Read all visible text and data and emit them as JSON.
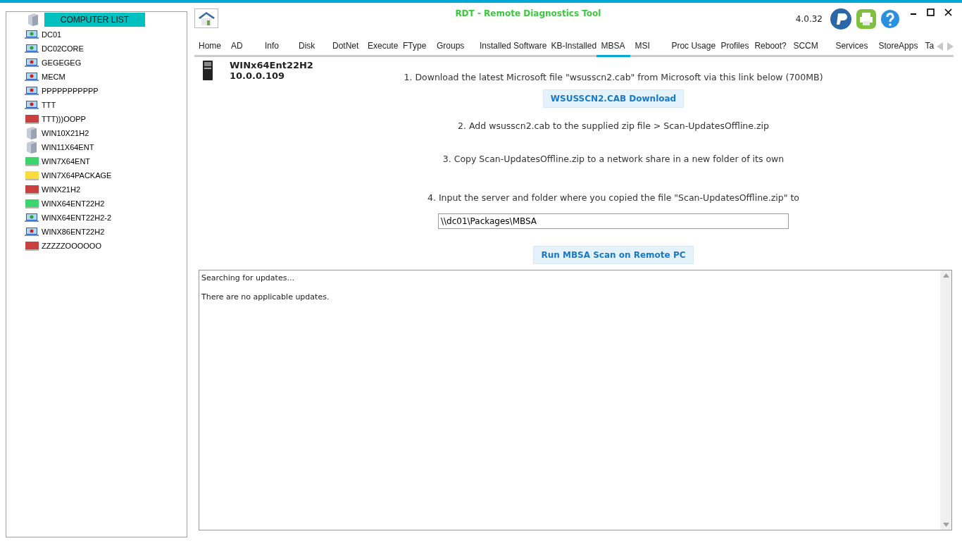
{
  "computer_list": {
    "title": "COMPUTER LIST",
    "items": [
      {
        "name": "DC01",
        "kind": "laptop-ok"
      },
      {
        "name": "DC02CORE",
        "kind": "laptop-ok"
      },
      {
        "name": "GEGEGEG",
        "kind": "laptop-alert"
      },
      {
        "name": "MECM",
        "kind": "laptop-alert"
      },
      {
        "name": "PPPPPPPPPPP",
        "kind": "laptop-alert"
      },
      {
        "name": "TTT",
        "kind": "laptop-alert"
      },
      {
        "name": "TTT)))OOPP",
        "kind": "status",
        "color": "#c84040"
      },
      {
        "name": "WIN10X21H2",
        "kind": "server"
      },
      {
        "name": "WIN11X64ENT",
        "kind": "server"
      },
      {
        "name": "WIN7X64ENT",
        "kind": "status",
        "color": "#3cd46c"
      },
      {
        "name": "WIN7X64PACKAGE",
        "kind": "status",
        "color": "#fadc3c"
      },
      {
        "name": "WINX21H2",
        "kind": "status",
        "color": "#c84040"
      },
      {
        "name": "WINX64ENT22H2",
        "kind": "status",
        "color": "#3cd46c"
      },
      {
        "name": "WINX64ENT22H2-2",
        "kind": "laptop-ok"
      },
      {
        "name": "WINX86ENT22H2",
        "kind": "laptop-alert"
      },
      {
        "name": "ZZZZZOOOOOO",
        "kind": "status",
        "color": "#c84040"
      }
    ]
  },
  "window": {
    "title": "RDT - Remote Diagnostics Tool",
    "version": "4.0.32"
  },
  "tabs": [
    {
      "label": "Home",
      "selected": false
    },
    {
      "label": "AD",
      "selected": false
    },
    {
      "label": "Info",
      "selected": false
    },
    {
      "label": "Disk",
      "selected": false
    },
    {
      "label": "DotNet",
      "selected": false
    },
    {
      "label": "Execute",
      "selected": false
    },
    {
      "label": "FType",
      "selected": false
    },
    {
      "label": "Groups",
      "selected": false
    },
    {
      "label": "Installed Software",
      "selected": false
    },
    {
      "label": "KB-Installed",
      "selected": false
    },
    {
      "label": "MBSA",
      "selected": true
    },
    {
      "label": "MSI",
      "selected": false
    },
    {
      "label": "Proc Usage",
      "selected": false
    },
    {
      "label": "Profiles",
      "selected": false
    },
    {
      "label": "Reboot?",
      "selected": false
    },
    {
      "label": "SCCM",
      "selected": false
    },
    {
      "label": "Services",
      "selected": false
    },
    {
      "label": "StoreApps",
      "selected": false
    },
    {
      "label": "Ta",
      "selected": false
    }
  ],
  "machine": {
    "name": "WINx64Ent22H2",
    "ip": "10.0.0.109"
  },
  "mbsa": {
    "step_1": "1. Download the latest Microsoft file \"wsusscn2.cab\" from Microsoft via this link below (700MB)",
    "download_button": "WSUSSCN2.CAB Download",
    "step_2": "2. Add wsusscn2.cab to the supplied zip file > Scan-UpdatesOffline.zip",
    "step_3": "3. Copy Scan-UpdatesOffline.zip to a network share in a new folder of its own",
    "step_4": "4. Input the server and folder where you copied the file \"Scan-UpdatesOffline.zip\" to",
    "share_path": "\\\\dc01\\Packages\\MBSA",
    "run_button": "Run MBSA Scan on Remote PC",
    "output": [
      "Searching for updates...",
      "There are no applicable updates."
    ]
  }
}
